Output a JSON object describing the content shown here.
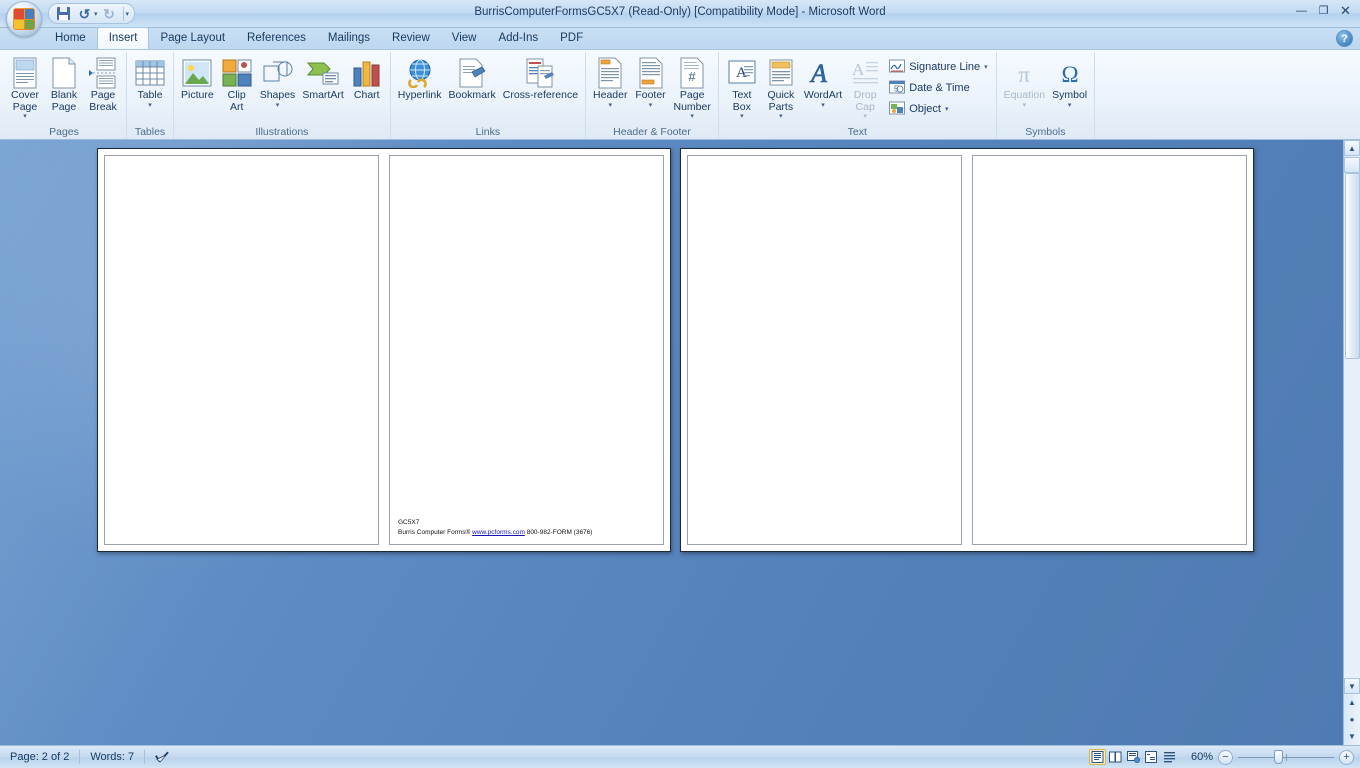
{
  "window": {
    "title": "BurrisComputerFormsGC5X7 (Read-Only) [Compatibility Mode] - Microsoft Word",
    "minimize_label": "—",
    "restore_label": "❐",
    "close_label": "✕",
    "help_label": "?"
  },
  "quick_access": {
    "office_button": "office-button",
    "save_label": "Save",
    "undo_label": "↺",
    "undo_caret": "▾",
    "redo_label": "↻",
    "customize_caret": "▾"
  },
  "tabs": [
    {
      "label": "Home",
      "active": false
    },
    {
      "label": "Insert",
      "active": true
    },
    {
      "label": "Page Layout",
      "active": false
    },
    {
      "label": "References",
      "active": false
    },
    {
      "label": "Mailings",
      "active": false
    },
    {
      "label": "Review",
      "active": false
    },
    {
      "label": "View",
      "active": false
    },
    {
      "label": "Add-Ins",
      "active": false
    },
    {
      "label": "PDF",
      "active": false
    }
  ],
  "ribbon": {
    "groups": [
      {
        "name": "Pages",
        "label": "Pages",
        "buttons": [
          {
            "label": "Cover\nPage",
            "caret": "▾",
            "disabled": false
          },
          {
            "label": "Blank\nPage",
            "caret": "",
            "disabled": false
          },
          {
            "label": "Page\nBreak",
            "caret": "",
            "disabled": false
          }
        ]
      },
      {
        "name": "Tables",
        "label": "Tables",
        "buttons": [
          {
            "label": "Table",
            "caret": "▾",
            "disabled": false
          }
        ]
      },
      {
        "name": "Illustrations",
        "label": "Illustrations",
        "buttons": [
          {
            "label": "Picture",
            "caret": "",
            "disabled": false
          },
          {
            "label": "Clip\nArt",
            "caret": "",
            "disabled": false
          },
          {
            "label": "Shapes",
            "caret": "▾",
            "disabled": false
          },
          {
            "label": "SmartArt",
            "caret": "",
            "disabled": false
          },
          {
            "label": "Chart",
            "caret": "",
            "disabled": false
          }
        ]
      },
      {
        "name": "Links",
        "label": "Links",
        "buttons": [
          {
            "label": "Hyperlink",
            "caret": "",
            "disabled": false
          },
          {
            "label": "Bookmark",
            "caret": "",
            "disabled": false
          },
          {
            "label": "Cross-reference",
            "caret": "",
            "disabled": false
          }
        ]
      },
      {
        "name": "Header & Footer",
        "label": "Header & Footer",
        "buttons": [
          {
            "label": "Header",
            "caret": "▾",
            "disabled": false
          },
          {
            "label": "Footer",
            "caret": "▾",
            "disabled": false
          },
          {
            "label": "Page\nNumber",
            "caret": "▾",
            "disabled": false
          }
        ]
      },
      {
        "name": "Text",
        "label": "Text",
        "buttons": [
          {
            "label": "Text\nBox",
            "caret": "▾",
            "disabled": false
          },
          {
            "label": "Quick\nParts",
            "caret": "▾",
            "disabled": false
          },
          {
            "label": "WordArt",
            "caret": "▾",
            "disabled": false
          },
          {
            "label": "Drop\nCap",
            "caret": "▾",
            "disabled": true
          }
        ],
        "small_buttons": [
          {
            "label": "Signature Line",
            "caret": "▾",
            "disabled": false
          },
          {
            "label": "Date & Time",
            "caret": "",
            "disabled": false
          },
          {
            "label": "Object",
            "caret": "▾",
            "disabled": false
          }
        ]
      },
      {
        "name": "Symbols",
        "label": "Symbols",
        "buttons": [
          {
            "label": "Equation",
            "caret": "▾",
            "disabled": true,
            "glyph": "π"
          },
          {
            "label": "Symbol",
            "caret": "▾",
            "disabled": false,
            "glyph": "Ω"
          }
        ]
      }
    ]
  },
  "document": {
    "pages": [
      {
        "id": "page-1",
        "text_lines": []
      },
      {
        "id": "page-2",
        "text_lines": []
      },
      {
        "id": "page-3",
        "text_lines": []
      },
      {
        "id": "page-4",
        "text_lines": []
      }
    ],
    "footer_block": {
      "form_code": "GC5X7",
      "company": "Burris Computer Forms®",
      "link": "www.pcforms.com",
      "phone": "800-982-FORM (3676)"
    }
  },
  "scrollbar": {
    "up_arrow": "▲",
    "down_arrow": "▼",
    "split_handle": "split-bar",
    "previous_page": "▲",
    "browse_object": "●",
    "next_page": "▼"
  },
  "status_bar": {
    "page_label": "Page: 2 of 2",
    "words_label": "Words: 7",
    "proofing_label": "proofing-errors",
    "zoom_label": "60%",
    "zoom_out": "−",
    "zoom_in": "+",
    "views": [
      {
        "name": "print-layout",
        "active": true
      },
      {
        "name": "full-screen-reading",
        "active": false
      },
      {
        "name": "web-layout",
        "active": false
      },
      {
        "name": "outline",
        "active": false
      },
      {
        "name": "draft",
        "active": false
      }
    ]
  },
  "colors": {
    "accent": "#5582bb",
    "ribbon_bg": "#eaf2fa",
    "titlebar": "#c3dbf2",
    "link": "#1414b8",
    "active_view": "#fdf0c8"
  }
}
